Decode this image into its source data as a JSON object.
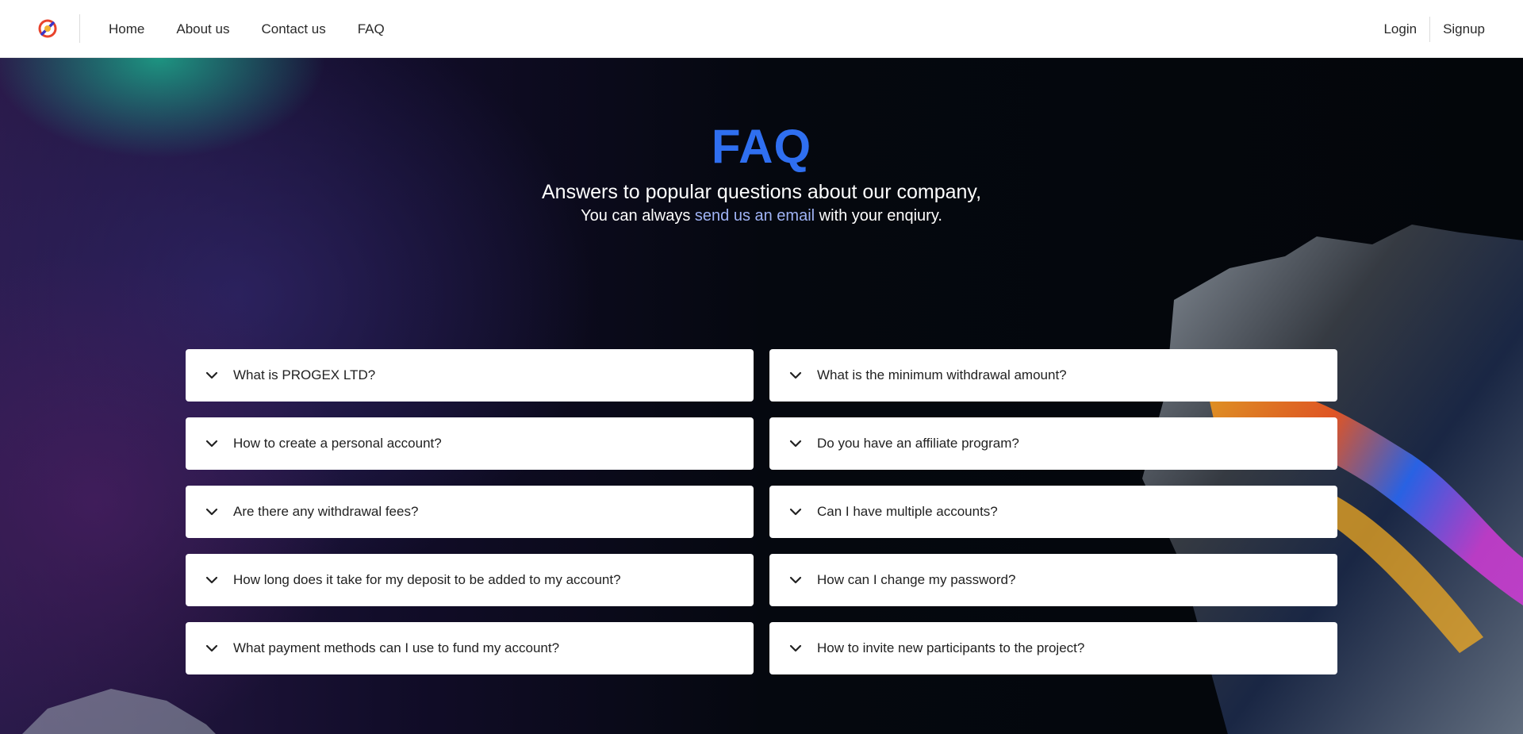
{
  "nav": {
    "logo": "logo-icon",
    "links": [
      "Home",
      "About us",
      "Contact us",
      "FAQ"
    ],
    "login": "Login",
    "signup": "Signup"
  },
  "hero": {
    "title": "FAQ",
    "subtitle_line1": "Answers to popular questions about our company,",
    "subtitle_line2_before": "You can always ",
    "subtitle_line2_link": "send us an email",
    "subtitle_line2_after": " with your enqiury."
  },
  "faq": {
    "left": [
      "What is PROGEX LTD?",
      "How to create a personal account?",
      "Are there any withdrawal fees?",
      "How long does it take for my deposit to be added to my account?",
      "What payment methods can I use to fund my account?"
    ],
    "right": [
      "What is the minimum withdrawal amount?",
      "Do you have an affiliate program?",
      "Can I have multiple accounts?",
      "How can I change my password?",
      "How to invite new participants to the project?"
    ]
  },
  "colors": {
    "accent": "#2f6ff0",
    "link": "#9fb3f5"
  }
}
